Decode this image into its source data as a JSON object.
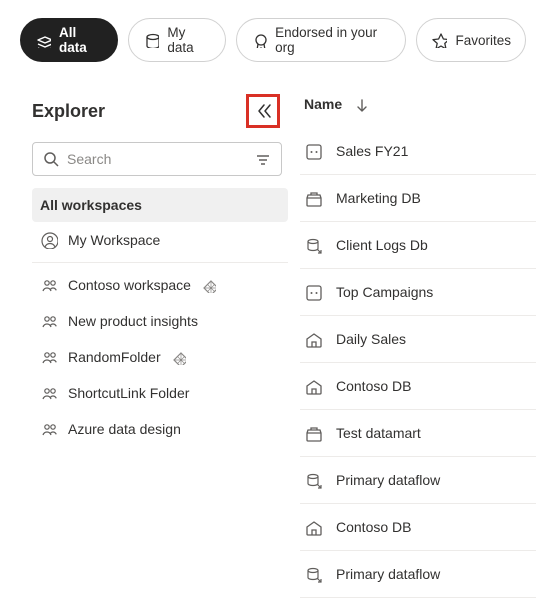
{
  "pills": [
    {
      "id": "all",
      "label": "All data",
      "icon": "stack-icon",
      "active": true
    },
    {
      "id": "mine",
      "label": "My data",
      "icon": "cylinder-icon",
      "active": false
    },
    {
      "id": "endorsed",
      "label": "Endorsed in your org",
      "icon": "badge-icon",
      "active": false
    },
    {
      "id": "fav",
      "label": "Favorites",
      "icon": "star-icon",
      "active": false
    }
  ],
  "explorer": {
    "title": "Explorer",
    "search_placeholder": "Search"
  },
  "workspaces": [
    {
      "id": "all",
      "label": "All workspaces",
      "icon": "",
      "selected": true,
      "endorsed": false
    },
    {
      "id": "myws",
      "label": "My Workspace",
      "icon": "person-icon",
      "selected": false,
      "endorsed": false
    },
    {
      "id": "contoso",
      "label": "Contoso workspace",
      "icon": "group-icon",
      "selected": false,
      "endorsed": true
    },
    {
      "id": "npi",
      "label": "New product insights",
      "icon": "group-icon",
      "selected": false,
      "endorsed": false
    },
    {
      "id": "rand",
      "label": "RandomFolder",
      "icon": "group-icon",
      "selected": false,
      "endorsed": true
    },
    {
      "id": "short",
      "label": "ShortcutLink Folder",
      "icon": "group-icon",
      "selected": false,
      "endorsed": false
    },
    {
      "id": "azure",
      "label": "Azure data design",
      "icon": "group-icon",
      "selected": false,
      "endorsed": false
    }
  ],
  "table": {
    "name_header": "Name"
  },
  "items": [
    {
      "label": "Sales FY21",
      "icon": "dataset-icon"
    },
    {
      "label": "Marketing DB",
      "icon": "datamart-icon"
    },
    {
      "label": "Client Logs Db",
      "icon": "dataflow-icon"
    },
    {
      "label": "Top Campaigns",
      "icon": "dataset-icon"
    },
    {
      "label": "Daily Sales",
      "icon": "house-icon"
    },
    {
      "label": "Contoso DB",
      "icon": "house-icon"
    },
    {
      "label": "Test datamart",
      "icon": "datamart-icon"
    },
    {
      "label": "Primary dataflow",
      "icon": "dataflow-icon"
    },
    {
      "label": "Contoso DB",
      "icon": "house-icon"
    },
    {
      "label": "Primary dataflow",
      "icon": "dataflow-icon"
    }
  ]
}
